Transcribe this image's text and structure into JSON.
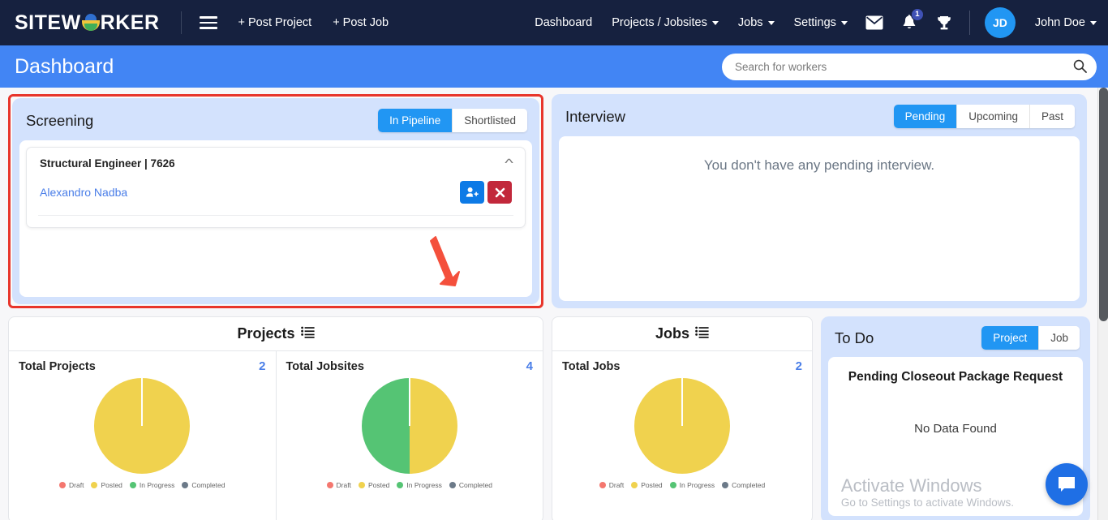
{
  "navbar": {
    "brand": "SITEWORKER",
    "menu_icon": "hamburger-icon",
    "post_project": "+ Post Project",
    "post_job": "+ Post Job",
    "links": [
      {
        "label": "Dashboard",
        "caret": false
      },
      {
        "label": "Projects / Jobsites",
        "caret": true
      },
      {
        "label": "Jobs",
        "caret": true
      },
      {
        "label": "Settings",
        "caret": true
      }
    ],
    "mail_icon": "mail-icon",
    "bell_icon": "bell-icon",
    "notification_count": "1",
    "trophy_icon": "trophy-icon",
    "avatar_initials": "JD",
    "user_name": "John Doe",
    "bg_color": "#16213f"
  },
  "page_header": {
    "title": "Dashboard",
    "bg_color": "#4285f4",
    "search": {
      "placeholder": "Search for workers",
      "value": "",
      "icon": "search-icon"
    }
  },
  "screening": {
    "title": "Screening",
    "tabs": [
      {
        "label": "In Pipeline",
        "active": true
      },
      {
        "label": "Shortlisted",
        "active": false
      }
    ],
    "highlight_color": "#e8352b",
    "job": {
      "title": "Structural Engineer | 7626",
      "collapse_icon": "chevron-up-icon",
      "candidate": "Alexandro Nadba",
      "actions": [
        {
          "name": "add-user-button",
          "icon": "user-plus-icon",
          "color": "#0d7ae6"
        },
        {
          "name": "reject-button",
          "icon": "close-x-icon",
          "color": "#c2283b"
        }
      ]
    }
  },
  "interview": {
    "title": "Interview",
    "tabs": [
      {
        "label": "Pending",
        "active": true
      },
      {
        "label": "Upcoming",
        "active": false
      },
      {
        "label": "Past",
        "active": false
      }
    ],
    "empty_message": "You don't have any pending interview."
  },
  "projects_card": {
    "title": "Projects",
    "list_icon": "list-icon",
    "panels": [
      {
        "label": "Total Projects",
        "value": "2"
      },
      {
        "label": "Total Jobsites",
        "value": "4"
      }
    ]
  },
  "jobs_card": {
    "title": "Jobs",
    "list_icon": "list-icon",
    "panel": {
      "label": "Total Jobs",
      "value": "2"
    }
  },
  "todo": {
    "title": "To Do",
    "tabs": [
      {
        "label": "Project",
        "active": true
      },
      {
        "label": "Job",
        "active": false
      }
    ],
    "heading": "Pending Closeout Package Request",
    "empty_message": "No Data Found"
  },
  "watermark": {
    "line1": "Activate Windows",
    "line2": "Go to Settings to activate Windows."
  },
  "chat_fab": {
    "icon": "chat-bubble-icon",
    "color": "#1f6fe5"
  },
  "legend_colors": {
    "draft": "#f4776f",
    "posted": "#f0d24e",
    "in_progress": "#55c474",
    "completed": "#6c7a89"
  },
  "chart_data": [
    {
      "type": "pie",
      "title": "Total Projects",
      "total": 2,
      "categories": [
        "Draft",
        "Posted",
        "In Progress",
        "Completed"
      ],
      "values": [
        0,
        2,
        0,
        0
      ],
      "colors": [
        "#f4776f",
        "#f0d24e",
        "#55c474",
        "#6c7a89"
      ],
      "legend_position": "bottom"
    },
    {
      "type": "pie",
      "title": "Total Jobsites",
      "total": 4,
      "categories": [
        "Draft",
        "Posted",
        "In Progress",
        "Completed"
      ],
      "values": [
        0,
        2,
        2,
        0
      ],
      "colors": [
        "#f4776f",
        "#f0d24e",
        "#55c474",
        "#6c7a89"
      ],
      "legend_position": "bottom"
    },
    {
      "type": "pie",
      "title": "Total Jobs",
      "total": 2,
      "categories": [
        "Draft",
        "Posted",
        "In Progress",
        "Completed"
      ],
      "values": [
        0,
        2,
        0,
        0
      ],
      "colors": [
        "#f4776f",
        "#f0d24e",
        "#55c474",
        "#6c7a89"
      ],
      "legend_position": "bottom"
    }
  ]
}
